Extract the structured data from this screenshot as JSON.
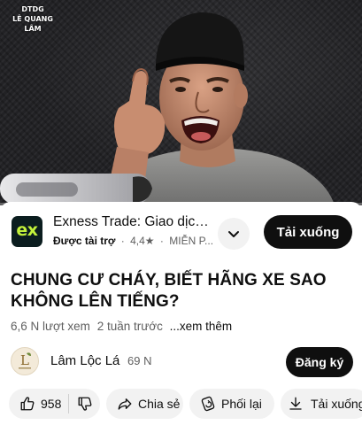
{
  "player": {
    "watermark_line1": "DTDG",
    "watermark_line2": "LÊ QUANG LÂM",
    "progress_fraction": 0.0
  },
  "ad": {
    "logo_text": "ex",
    "title": "Exness Trade: Giao dịch...",
    "sponsored_label": "Được tài trợ",
    "separator": "·",
    "rating": "4,4★",
    "price": "MIỄN P...",
    "download_label": "Tải xuống",
    "icons": {
      "more": "chevron-down-icon"
    }
  },
  "video": {
    "title": "CHUNG CƯ CHÁY, BIẾT HÃNG XE SAO KHÔNG LÊN TIẾNG?",
    "views": "6,6 N lượt xem",
    "age": "2 tuần trước",
    "more_label": "...xem thêm"
  },
  "channel": {
    "avatar_letter": "L",
    "name": "Lâm Lộc Lá",
    "subscribers": "69 N",
    "subscribe_label": "Đăng ký"
  },
  "actions": {
    "like_count": "958",
    "share_label": "Chia sẻ",
    "remix_label": "Phối lại",
    "download_label": "Tải xuống",
    "icons": [
      "thumb-up-icon",
      "thumb-down-icon",
      "share-icon",
      "remix-icon",
      "download-icon"
    ]
  },
  "colors": {
    "primary_button": "#0f0f0f",
    "chip_background": "#f2f2f2",
    "secondary_text": "#606060",
    "ad_logo_bg": "#0b1d1f",
    "ad_logo_fg": "#c3f23b"
  }
}
